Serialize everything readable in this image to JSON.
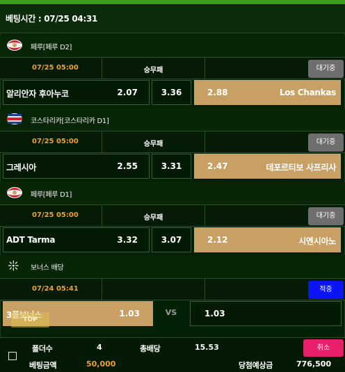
{
  "header": {
    "betting_time": "베팅시간 : 07/25 04:31"
  },
  "games": [
    {
      "league": "페루[페루 D2]",
      "flag": "peru-flag-icon",
      "time": "07/25 05:00",
      "market": "승무패",
      "status": "대기중",
      "home": {
        "name": "알리안자 후아누코",
        "odds": "2.07"
      },
      "draw": {
        "odds": "3.36"
      },
      "away": {
        "name": "Los Chankas",
        "odds": "2.88",
        "selected": true
      }
    },
    {
      "league": "코스타리카[코스타리카 D1]",
      "flag": "costa-rica-flag-icon",
      "time": "07/25 05:00",
      "market": "승무패",
      "status": "대기중",
      "home": {
        "name": "그레시아",
        "odds": "2.55"
      },
      "draw": {
        "odds": "3.31"
      },
      "away": {
        "name": "데포르티보 사프리사",
        "odds": "2.47",
        "selected": true
      }
    },
    {
      "league": "페루[페루 D1]",
      "flag": "peru-flag-icon",
      "time": "07/25 05:00",
      "market": "승무패",
      "status": "대기중",
      "home": {
        "name": "ADT Tarma",
        "odds": "3.32"
      },
      "draw": {
        "odds": "3.07"
      },
      "away": {
        "name": "시엔시아노",
        "odds": "2.12",
        "selected": true
      }
    }
  ],
  "bonus": {
    "league": "보너스 배당",
    "icon": "bonus-sparkle-icon",
    "time": "07/24 05:41",
    "status": "적중",
    "left": {
      "name": "3폴보너스",
      "odds": "1.03"
    },
    "vs": "VS",
    "right": {
      "odds": "1.03"
    },
    "top_button": "TOP"
  },
  "summary": {
    "folder_label": "폴더수",
    "folder_value": "4",
    "total_odds_label": "총배당",
    "total_odds_value": "15.53",
    "cancel_label": "취소",
    "bet_amount_label": "베팅금액",
    "bet_amount_value": "50,000",
    "expected_win_label": "당첨예상금",
    "expected_win_value": "776,500"
  },
  "colors": {
    "accent_orange": "#f0a030",
    "selected_bg": "#c8a064",
    "waiting_gray": "#6e6e6e",
    "win_blue": "#0a14f4",
    "cancel_pink": "#e8206b"
  }
}
